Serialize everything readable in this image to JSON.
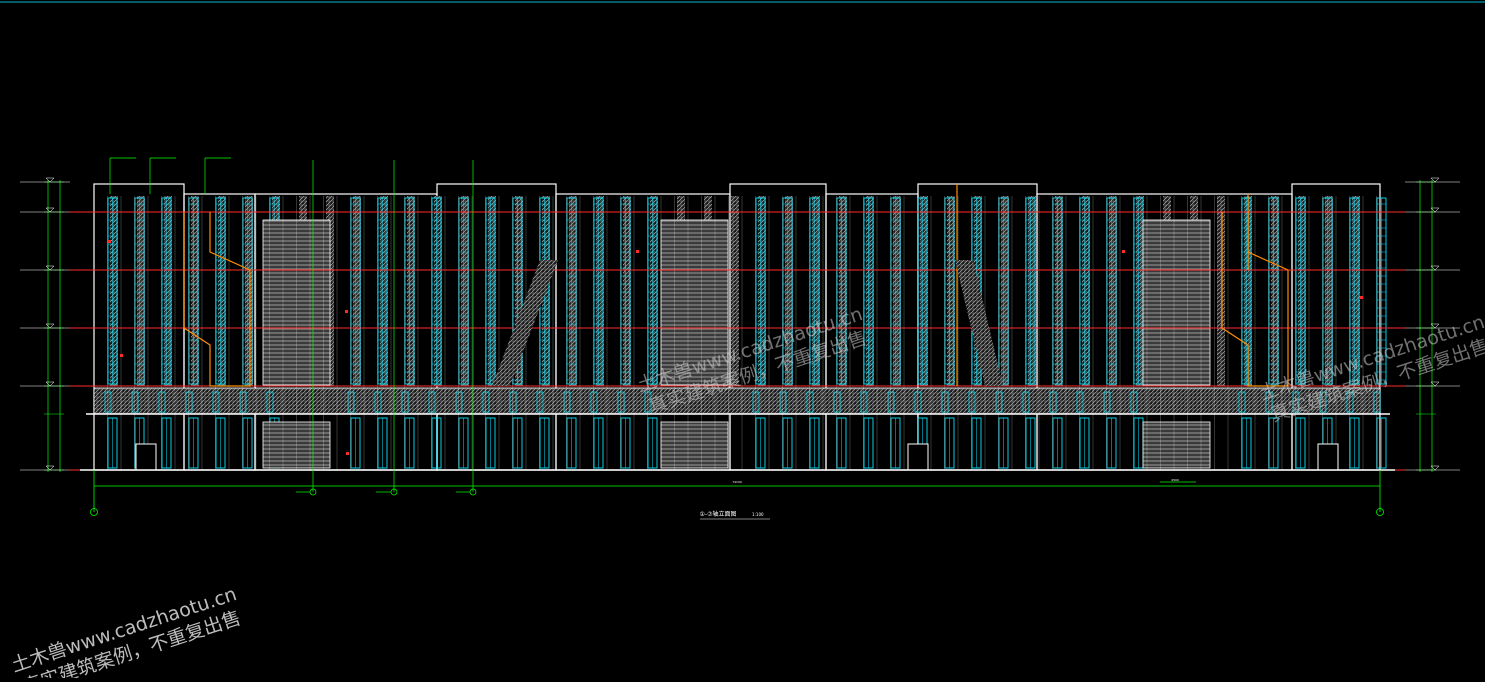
{
  "drawing": {
    "title": "①-⑦轴立面图",
    "scale": "1:100"
  },
  "dimension": {
    "total": "74100",
    "sub": "4500"
  },
  "watermark": {
    "line1": "土木兽www.cadzhaotu.cn",
    "line2": "真实建筑案例，不重复出售"
  },
  "colors": {
    "background": "#000000",
    "outline": "#ffffff",
    "glass": "#00e5ff",
    "levels": "#ff2a2a",
    "dims": "#00ff00",
    "accent": "#ff8c00",
    "hatch": "#9a9a9a",
    "topline": "#00bcd4"
  }
}
